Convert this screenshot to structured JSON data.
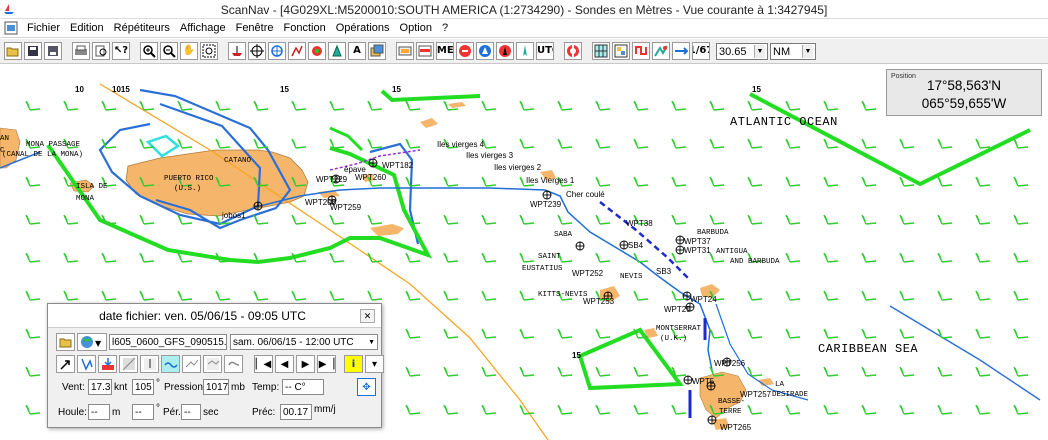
{
  "window": {
    "title": "ScanNav - [4G029XL:M5200010:SOUTH AMERICA (1:2734290) - Sondes en  Mètres  - Vue courante à 1:3427945]"
  },
  "menu": {
    "items": [
      "Fichier",
      "Edition",
      "Répétiteurs",
      "Affichage",
      "Fenêtre",
      "Fonction",
      "Opérations",
      "Option",
      "?"
    ]
  },
  "toolbar": {
    "value_field": "30.65",
    "unit_select": "NM",
    "icons": [
      "open-file",
      "save",
      "save-as",
      "print",
      "print-preview",
      "help-pointer",
      "zoom-in",
      "zoom-out",
      "pan",
      "zoom-box",
      "boat",
      "crosshair",
      "route",
      "waypoint",
      "track",
      "marker",
      "text",
      "chart-layers",
      "nmea",
      "gps",
      "stop",
      "engine",
      "autopilot",
      "lifebuoy",
      "grid",
      "tide",
      "current",
      "weather",
      "wind",
      "barometer"
    ]
  },
  "position_panel": {
    "label": "Position",
    "latitude": "17°58,563'N",
    "longitude": "065°59,655'W"
  },
  "grib_panel": {
    "title": "date fichier: ven. 05/06/15 - 09:05 UTC",
    "file": "l605_0600_GFS_090515.grb",
    "date_select": "sam. 06/06/15 - 12:00 UTC",
    "wind_label": "Vent:",
    "wind_speed": "17.3",
    "wind_unit": "knt",
    "wind_dir": "105",
    "deg": "°",
    "pressure_label": "Pression:",
    "pressure": "1017",
    "pressure_unit": "mb",
    "temp_label": "Temp:",
    "temp": "-- C°",
    "swell_label": "Houle:",
    "swell": "--",
    "swell_unit": "m",
    "swell_dir": "--",
    "period_label": "Pér.",
    "period": "--",
    "period_unit": "sec",
    "precip_label": "Préc:",
    "precip": "00.17",
    "precip_unit": "mm/j"
  },
  "map": {
    "ocean_labels": [
      "ATLANTIC OCEAN",
      "CARIBBEAN SEA"
    ],
    "place_labels": [
      "PUERTO RICO",
      "(U.S.)",
      "CATANO",
      "MONA PASSAGE",
      "(CANAL DE LA MONA)",
      "ISLA DE",
      "MONA",
      "BARBUDA",
      "ANTIGUA",
      "AND BARBUDA",
      "SABA",
      "SAINT",
      "EUSTATIUS",
      "NEVIS",
      "KITTS-NEVIS",
      "MONTSERRAT",
      "(U.K.)",
      "BASSE-",
      "TERRE",
      "LA",
      "DESIRADE",
      "AN",
      "C"
    ],
    "waypoint_labels": [
      "WPT229",
      "WPT208",
      "WPT259",
      "WPT260",
      "jobos1",
      "WPT182",
      "WPT239",
      "WPT38",
      "WPT37",
      "WPT31",
      "WPT24",
      "WPT25",
      "WPT256",
      "WPT257",
      "WPT5",
      "WPT265",
      "WPT252",
      "WPT253",
      "SB4",
      "SB3",
      "Iles vierges 4",
      "Iles vierges 3",
      "Iles vierges 2",
      "Iles Vierges 1",
      "épave",
      "Cher coulé"
    ],
    "depth_labels": [
      "10",
      "1015",
      "15",
      "15",
      "15",
      "15"
    ],
    "colors": {
      "route": "#1e6fd9",
      "isobar": "#3a8ee6",
      "wind_barb": "#33cc33",
      "boundary": "#22dd22",
      "land": "#f5b66b",
      "track": "#f5a623"
    }
  }
}
